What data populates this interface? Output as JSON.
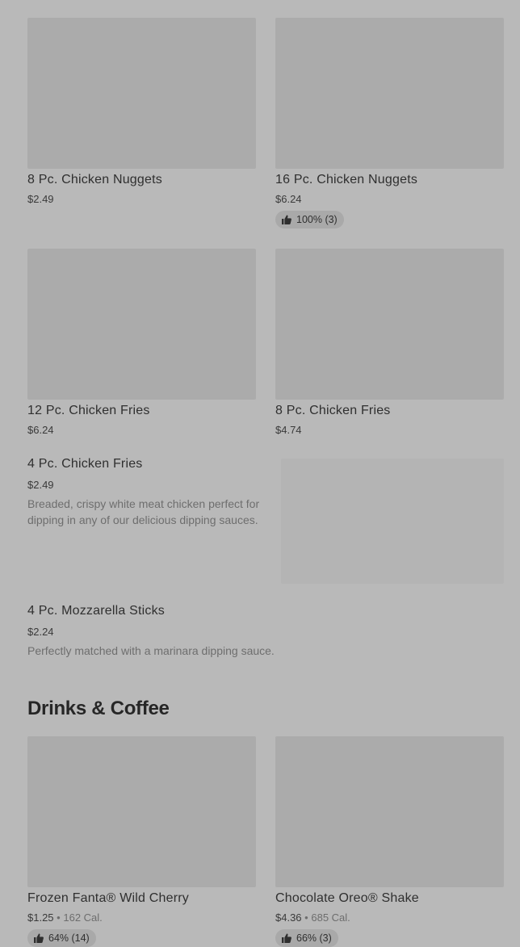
{
  "items": [
    {
      "name": "8 Pc. Chicken Nuggets",
      "price": "$2.49"
    },
    {
      "name": "16 Pc. Chicken Nuggets",
      "price": "$6.24",
      "rating": "100% (3)"
    },
    {
      "name": "12 Pc. Chicken Fries",
      "price": "$6.24"
    },
    {
      "name": "8 Pc. Chicken Fries",
      "price": "$4.74"
    },
    {
      "name": "4 Pc. Chicken Fries",
      "price": "$2.49",
      "description": "Breaded, crispy white meat chicken perfect for dipping in any of our delicious dipping sauces."
    },
    {
      "name": "4 Pc. Mozzarella Sticks",
      "price": "$2.24",
      "description": "Perfectly matched with a marinara dipping sauce."
    }
  ],
  "drinks_section": {
    "title": "Drinks & Coffee",
    "items": [
      {
        "name": "Frozen Fanta® Wild Cherry",
        "price": "$1.25",
        "separator": "•",
        "calories": "162 Cal.",
        "rating": "64% (14)"
      },
      {
        "name": "Chocolate Oreo® Shake",
        "price": "$4.36",
        "separator": "•",
        "calories": "685 Cal.",
        "rating": "66% (3)"
      }
    ]
  },
  "icons": {
    "rating": "thumbs-up-icon"
  }
}
